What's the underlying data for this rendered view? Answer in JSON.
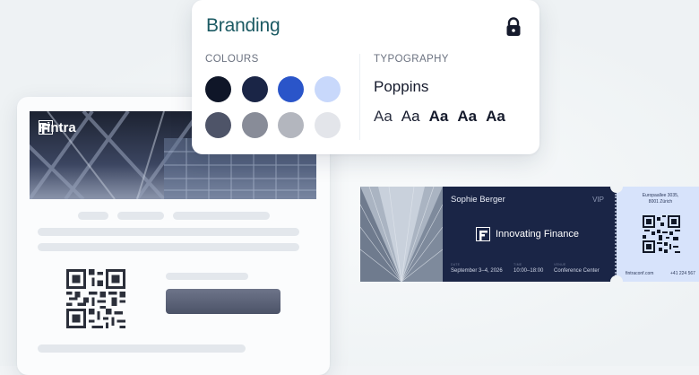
{
  "email": {
    "brand_name": "Fintra"
  },
  "branding": {
    "title": "Branding",
    "colours_label": "COLOURS",
    "typography_label": "TYPOGRAPHY",
    "font_name": "Poppins",
    "swatches": [
      "#0f1628",
      "#1a2546",
      "#2a55c9",
      "#c8d8fb",
      "#4e5468",
      "#888c98",
      "#b3b6be",
      "#e3e5ea"
    ],
    "samples": [
      "Aa",
      "Aa",
      "Aa",
      "Aa",
      "Aa"
    ]
  },
  "ticket": {
    "attendee": "Sophie Berger",
    "tier": "VIP",
    "event": "Innovating Finance",
    "date_label": "DATE",
    "date": "September 3–4, 2026",
    "time_label": "TIME",
    "time": "10:00–18:00",
    "venue_label": "VENUE",
    "venue": "Conference Center",
    "address_line1": "Europaallee 3035,",
    "address_line2": "8001 Zürich",
    "website": "fintraconf.com",
    "phone": "+41 224 567"
  },
  "colors": {
    "accent": "#1b5a63",
    "ticket_dark": "#1a2546",
    "ticket_stub": "#d7e3fb"
  }
}
